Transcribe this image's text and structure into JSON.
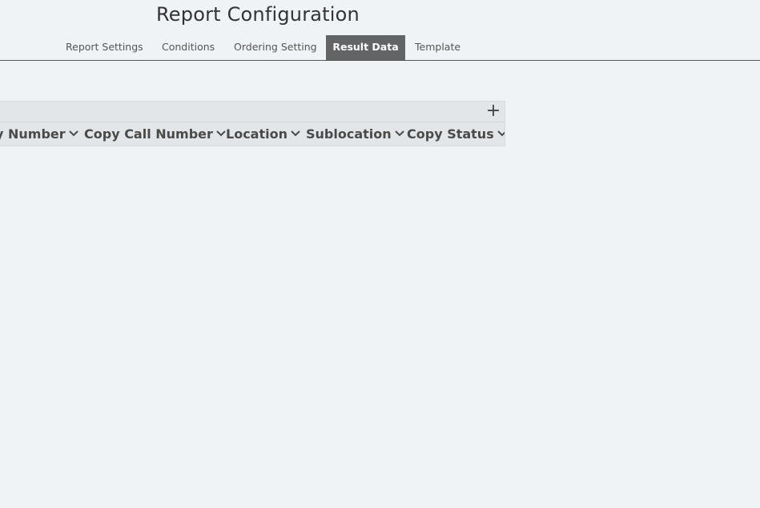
{
  "page": {
    "title": "Report Configuration"
  },
  "tabs": [
    {
      "label": "Report Settings",
      "active": false
    },
    {
      "label": "Conditions",
      "active": false
    },
    {
      "label": "Ordering Setting",
      "active": false
    },
    {
      "label": "Result Data",
      "active": true
    },
    {
      "label": "Template",
      "active": false
    }
  ],
  "table": {
    "add_column_icon": "plus-icon",
    "add_column_glyph": "+",
    "columns": [
      {
        "label": "y Number",
        "icon": "chevron-down-icon"
      },
      {
        "label": "Copy Call Number",
        "icon": "chevron-down-icon"
      },
      {
        "label": "Location",
        "icon": "chevron-down-icon"
      },
      {
        "label": "Sublocation",
        "icon": "chevron-down-icon"
      },
      {
        "label": "Copy Status",
        "icon": "chevron-down-icon"
      }
    ]
  },
  "colors": {
    "background": "#eff3f6",
    "active_tab": "#636466",
    "header_bg": "#e3e6e8"
  }
}
